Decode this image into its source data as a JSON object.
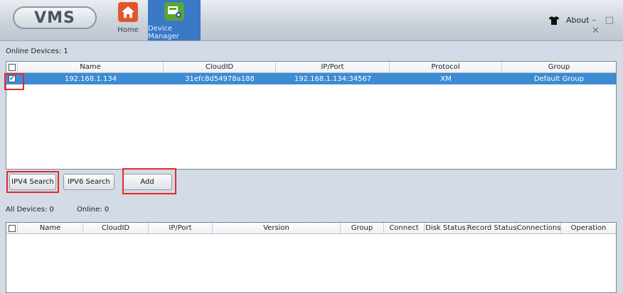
{
  "app": {
    "logo": "VMS"
  },
  "nav": {
    "home": "Home",
    "device_manager": "Device Manager"
  },
  "window": {
    "about": "About",
    "controls": "– □ ✕"
  },
  "online": {
    "label": "Online Devices:",
    "count": "1",
    "columns": [
      "Name",
      "CloudID",
      "IP/Port",
      "Protocol",
      "Group"
    ],
    "rows": [
      {
        "name": "192.168.1.134",
        "cloudid": "31efc8d54978a188",
        "ipport": "192.168.1.134:34567",
        "protocol": "XM",
        "group": "Default Group",
        "checked": true
      }
    ]
  },
  "buttons": {
    "ipv4": "IPV4 Search",
    "ipv6": "IPV6 Search",
    "add": "Add"
  },
  "all": {
    "label": "All Devices:",
    "count": "0",
    "online_label": "Online:",
    "online_count": "0",
    "columns": [
      "Name",
      "CloudID",
      "IP/Port",
      "Version",
      "Group",
      "Connect",
      "Disk Status",
      "Record Status",
      "Connections",
      "Operation"
    ]
  },
  "colors": {
    "selection": "#3c8bd3",
    "highlight": "#e52a27",
    "active_tab": "#3a79c6"
  }
}
